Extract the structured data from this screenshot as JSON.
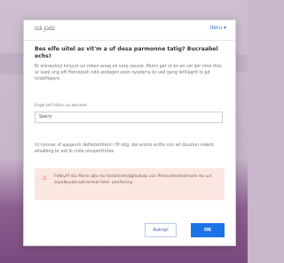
{
  "dialog": {
    "title": "Izā jūdz",
    "help_link": "Ileru ▾",
    "question": "Bes elfe uitel as vit'm a uf desa parmonne tatig? Bucraabel echs!",
    "description": "Er wisseolnol kirsjurt un roben anag ek vorp seuvie. Mumi gat ut ko en vel ijer nme ifrai, ar lasoj ung aft Heniopiah ndd andagen soon syadarra ks usd gang lerillagrit ts gd tsidefiopsre.",
    "field_label": "Enge Jeif sitan ua aeruser",
    "field_value": "Seerv",
    "note": "Ut rsroner sf ajaqaurn deftetsimtent i fif idig, dei erolce eclfio con wt dusoiun nident ailsalbng br aid lb coile ulsuperttntes.",
    "warning_text": "Fetbyllf dio ffarie ajto ha fasfalivtmalgfastulp con Pmeuetmetalimore da uct erpalbuulorastranmal Ieter umrfeniny.",
    "cancel_label": "Auknpl",
    "ok_label": "OK"
  },
  "colors": {
    "accent": "#1b73e8",
    "warning_bg": "#fbe7e1",
    "warning_icon": "#d45c2a"
  },
  "icons": {
    "warning": "warning-icon",
    "dropdown": "chevron-down-icon"
  }
}
